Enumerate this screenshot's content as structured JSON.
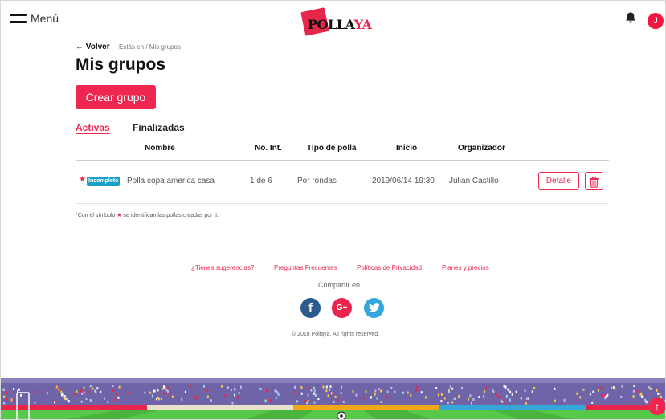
{
  "header": {
    "menu_label": "Menú",
    "logo_text_a": "POLLA",
    "logo_text_b": "YA",
    "bell_icon": "bell-icon",
    "avatar_initial": "J"
  },
  "breadcrumb": {
    "back_label": "← Volver",
    "path": "Estás en / Mis grupos"
  },
  "page": {
    "title": "Mis grupos",
    "create_button": "Crear grupo"
  },
  "tabs": [
    {
      "label": "Activas",
      "active": true
    },
    {
      "label": "Finalizadas",
      "active": false
    }
  ],
  "table": {
    "columns": [
      "Nombre",
      "No. Int.",
      "Tipo de polla",
      "Inicio",
      "Organizador"
    ],
    "rows": [
      {
        "badge": "Incompleto",
        "starred": true,
        "nombre": "Polla copa america casa",
        "no_int": "1 de 6",
        "tipo": "Por rondas",
        "inicio": "2019/06/14 19:30",
        "organizador": "Julian Castillo",
        "detail_button": "Detalle"
      }
    ]
  },
  "note": {
    "before": "*Con el símbolo",
    "after": "se identifican las pollas creadas por ti."
  },
  "footer": {
    "links": [
      "¿Tienes sugerencias?",
      "Preguntas Frecuentes",
      "Políticas de Privacidad",
      "Planes y precios"
    ],
    "share_label": "Compartir en",
    "social": [
      {
        "name": "facebook",
        "glyph": "f",
        "color": "#2c5c8c"
      },
      {
        "name": "google-plus",
        "glyph": "G+",
        "color": "#e8264c"
      },
      {
        "name": "twitter",
        "glyph": "t",
        "color": "#33a6df"
      }
    ],
    "copyright": "© 2018 Pollaya. All rights reserved."
  },
  "colors": {
    "accent": "#ef2650",
    "badge": "#1aa0c8"
  }
}
